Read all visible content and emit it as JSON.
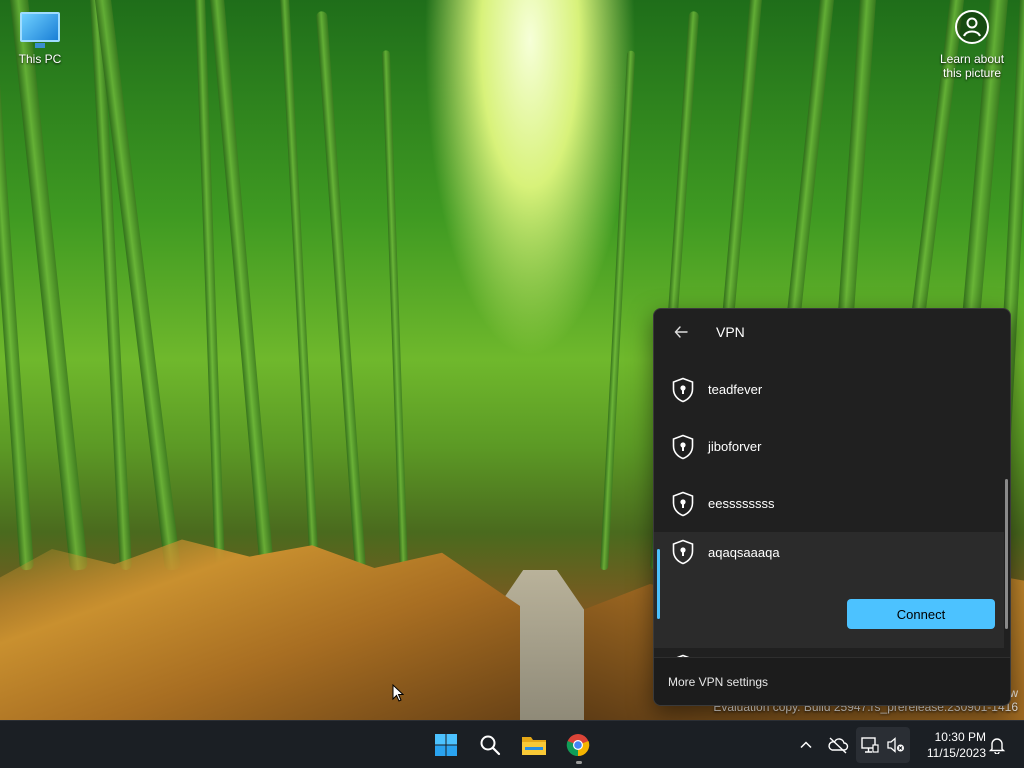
{
  "desktop": {
    "this_pc_label": "This PC",
    "learn_line1": "Learn about",
    "learn_line2": "this picture",
    "watermark_w": "w",
    "watermark": "Evaluation copy. Build 25947.rs_prerelease.230901-1416"
  },
  "vpn_flyout": {
    "title": "VPN",
    "connections": [
      {
        "name": "teadfever"
      },
      {
        "name": "jiboforver"
      },
      {
        "name": "eessssssss"
      },
      {
        "name": "aqaqsaaaqa",
        "connect_label": "Connect"
      }
    ],
    "more_settings_label": "More VPN settings"
  },
  "taskbar": {
    "apps": [
      "start-icon",
      "search-icon",
      "file-explorer-icon",
      "chrome-icon"
    ],
    "tray": [
      "chevron-up-icon",
      "onedrive-off-icon",
      "network-icon",
      "speaker-muted-icon",
      "notification-bell-icon"
    ],
    "time": "10:30 PM",
    "date": "11/15/2023"
  },
  "colors": {
    "accent": "#4cc2ff",
    "flyout_bg": "#202020",
    "taskbar_bg": "#1b1f24"
  }
}
